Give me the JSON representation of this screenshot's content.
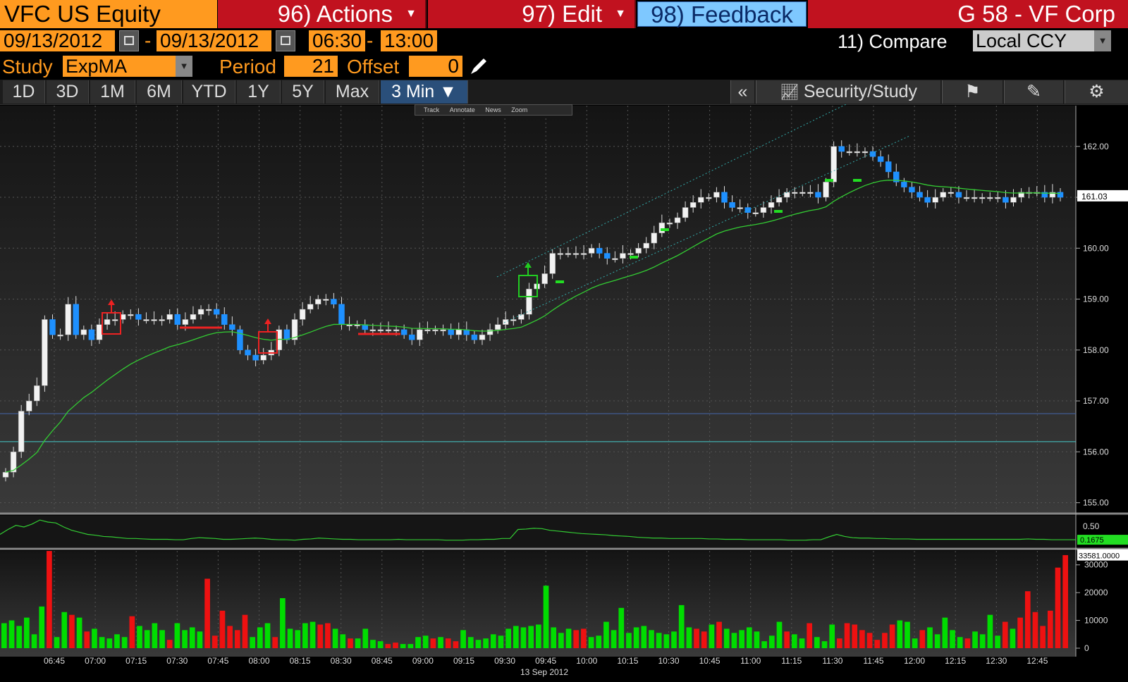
{
  "header": {
    "security": "VFC US Equity",
    "actions_label": "96) Actions",
    "edit_label": "97) Edit",
    "feedback_label": "98) Feedback",
    "title": "G 58 - VF Corp"
  },
  "controls": {
    "start_date": "09/13/2012",
    "end_date": "09/13/2012",
    "date_sep": "-",
    "start_time": "06:30",
    "time_sep": "-",
    "end_time": "13:00",
    "compare_label": "11) Compare",
    "currency": "Local CCY",
    "study_label": "Study",
    "study_value": "ExpMA",
    "period_label": "Period",
    "period_value": "21",
    "offset_label": "Offset",
    "offset_value": "0"
  },
  "ranges": [
    "1D",
    "3D",
    "1M",
    "6M",
    "YTD",
    "1Y",
    "5Y",
    "Max",
    "3 Min ▼"
  ],
  "active_range": "3 Min ▼",
  "toolbar": {
    "collapse": "«",
    "security_study": "Security/Study"
  },
  "minitool": [
    "Track",
    "Annotate",
    "News",
    "Zoom"
  ],
  "colors": {
    "bg": "#000000",
    "plot_bg_top": "#141414",
    "plot_bg_bottom": "#3a3a3a",
    "up_candle": "#ffffff",
    "down_candle": "#1e90ff",
    "ema": "#33cc33",
    "vol_up": "#00dd00",
    "vol_down": "#ee1111",
    "accent": "#ff9a1f"
  },
  "chart_data": [
    {
      "type": "candlestick",
      "name": "price",
      "x_labels": [
        "06:45",
        "07:00",
        "07:15",
        "07:30",
        "07:45",
        "08:00",
        "08:15",
        "08:30",
        "08:45",
        "09:00",
        "09:15",
        "09:30",
        "09:45",
        "10:00",
        "10:15",
        "10:30",
        "10:45",
        "11:00",
        "11:15",
        "11:30",
        "11:45",
        "12:00",
        "12:15",
        "12:30",
        "12:45"
      ],
      "date_label": "13 Sep 2012",
      "y_ticks": [
        "162.00",
        "161.00",
        "160.00",
        "159.00",
        "158.00",
        "157.00",
        "156.00",
        "155.00"
      ],
      "ylim": [
        154.8,
        162.8
      ],
      "last_price": "161.03",
      "closes": [
        155.6,
        156.0,
        156.8,
        157.0,
        157.3,
        158.6,
        158.3,
        158.3,
        158.9,
        158.3,
        158.4,
        158.2,
        158.5,
        158.6,
        158.6,
        158.7,
        158.7,
        158.6,
        158.6,
        158.6,
        158.6,
        158.7,
        158.5,
        158.6,
        158.7,
        158.8,
        158.8,
        158.7,
        158.5,
        158.4,
        158.0,
        157.9,
        157.8,
        157.9,
        158.0,
        158.4,
        158.2,
        158.6,
        158.8,
        158.9,
        159.0,
        159.0,
        158.9,
        158.5,
        158.5,
        158.5,
        158.4,
        158.4,
        158.4,
        158.4,
        158.4,
        158.3,
        158.2,
        158.4,
        158.4,
        158.4,
        158.4,
        158.3,
        158.4,
        158.3,
        158.2,
        158.3,
        158.4,
        158.5,
        158.6,
        158.6,
        158.7,
        159.2,
        159.3,
        159.5,
        159.9,
        159.9,
        159.9,
        159.9,
        159.9,
        160.0,
        159.9,
        159.8,
        159.8,
        159.9,
        159.9,
        160.0,
        160.1,
        160.3,
        160.5,
        160.5,
        160.6,
        160.8,
        160.9,
        161.0,
        161.0,
        161.1,
        160.9,
        160.8,
        160.8,
        160.7,
        160.7,
        160.8,
        160.9,
        161.0,
        161.1,
        161.1,
        161.1,
        161.1,
        161.0,
        161.3,
        162.0,
        161.9,
        161.9,
        161.9,
        161.9,
        161.8,
        161.7,
        161.5,
        161.3,
        161.2,
        161.1,
        161.0,
        160.9,
        161.0,
        161.1,
        161.1,
        161.0,
        161.0,
        161.0,
        161.0,
        161.0,
        161.0,
        160.9,
        161.0,
        161.1,
        161.1,
        161.1,
        161.0,
        161.1,
        161.0
      ],
      "ema_label": "ExpMA 21"
    },
    {
      "type": "line",
      "name": "indicator",
      "y_ticks": [
        "0.50"
      ],
      "last_value": "0.1675",
      "values": [
        0.3,
        0.42,
        0.52,
        0.48,
        0.55,
        0.65,
        0.6,
        0.58,
        0.48,
        0.4,
        0.35,
        0.3,
        0.28,
        0.25,
        0.24,
        0.22,
        0.2,
        0.2,
        0.19,
        0.18,
        0.18,
        0.18,
        0.17,
        0.17,
        0.2,
        0.22,
        0.21,
        0.2,
        0.18,
        0.18,
        0.19,
        0.2,
        0.21,
        0.2,
        0.18,
        0.17,
        0.17,
        0.16,
        0.18,
        0.19,
        0.21,
        0.2,
        0.19,
        0.18,
        0.18,
        0.17,
        0.17,
        0.17,
        0.17,
        0.17,
        0.18,
        0.17,
        0.17,
        0.17,
        0.17,
        0.17,
        0.16,
        0.16,
        0.16,
        0.17,
        0.17,
        0.18,
        0.18,
        0.2,
        0.2,
        0.42,
        0.43,
        0.45,
        0.44,
        0.4,
        0.38,
        0.36,
        0.34,
        0.32,
        0.31,
        0.3,
        0.29,
        0.27,
        0.26,
        0.25,
        0.23,
        0.22,
        0.21,
        0.21,
        0.2,
        0.2,
        0.2,
        0.2,
        0.2,
        0.19,
        0.19,
        0.18,
        0.18,
        0.18,
        0.17,
        0.17,
        0.17,
        0.17,
        0.17,
        0.16,
        0.16,
        0.16,
        0.17,
        0.17,
        0.24,
        0.3,
        0.25,
        0.22,
        0.21,
        0.21,
        0.2,
        0.2,
        0.19,
        0.19,
        0.19,
        0.18,
        0.18,
        0.18,
        0.18,
        0.18,
        0.18,
        0.18,
        0.18,
        0.18,
        0.18,
        0.18,
        0.18,
        0.18,
        0.18,
        0.19,
        0.18,
        0.18,
        0.17,
        0.17,
        0.17,
        0.17
      ]
    },
    {
      "type": "bar",
      "name": "volume",
      "y_ticks": [
        "30000",
        "20000",
        "10000",
        "0"
      ],
      "ylim": [
        0,
        35000
      ],
      "last_value": "33581.0000",
      "values": [
        9000,
        10000,
        8000,
        11000,
        5000,
        15000,
        35000,
        4000,
        13000,
        12000,
        11000,
        6000,
        7000,
        4000,
        3500,
        5000,
        4000,
        11500,
        8000,
        6500,
        9000,
        6500,
        3000,
        9000,
        6500,
        7500,
        6000,
        25000,
        4500,
        13500,
        8000,
        6500,
        12000,
        4000,
        7500,
        9000,
        4000,
        18000,
        7000,
        6500,
        9000,
        9500,
        8500,
        9000,
        7000,
        5000,
        3500,
        3500,
        7000,
        3000,
        2500,
        1500,
        2000,
        1500,
        1500,
        4000,
        4500,
        3500,
        4000,
        3500,
        2500,
        6500,
        4000,
        3000,
        3500,
        5000,
        4500,
        7000,
        8000,
        7500,
        8000,
        8500,
        22500,
        7500,
        5500,
        7000,
        6500,
        7000,
        4000,
        4500,
        9500,
        6500,
        14500,
        5500,
        7500,
        8000,
        6500,
        5500,
        5000,
        6000,
        15500,
        7500,
        7000,
        6000,
        8500,
        9500,
        7000,
        5500,
        6500,
        7500,
        6000,
        2500,
        4500,
        9500,
        6000,
        5000,
        3500,
        9000,
        4000,
        2500,
        8500,
        3500,
        9000,
        8500,
        6500,
        5500,
        3000,
        5500,
        8500,
        10000,
        9500,
        3500,
        6500,
        7500,
        5000,
        11000,
        6500,
        4000,
        3500,
        6000,
        5000,
        12000,
        4500,
        9500,
        7000,
        11000,
        20500,
        13000,
        8000,
        13500,
        29000,
        33500
      ]
    }
  ]
}
